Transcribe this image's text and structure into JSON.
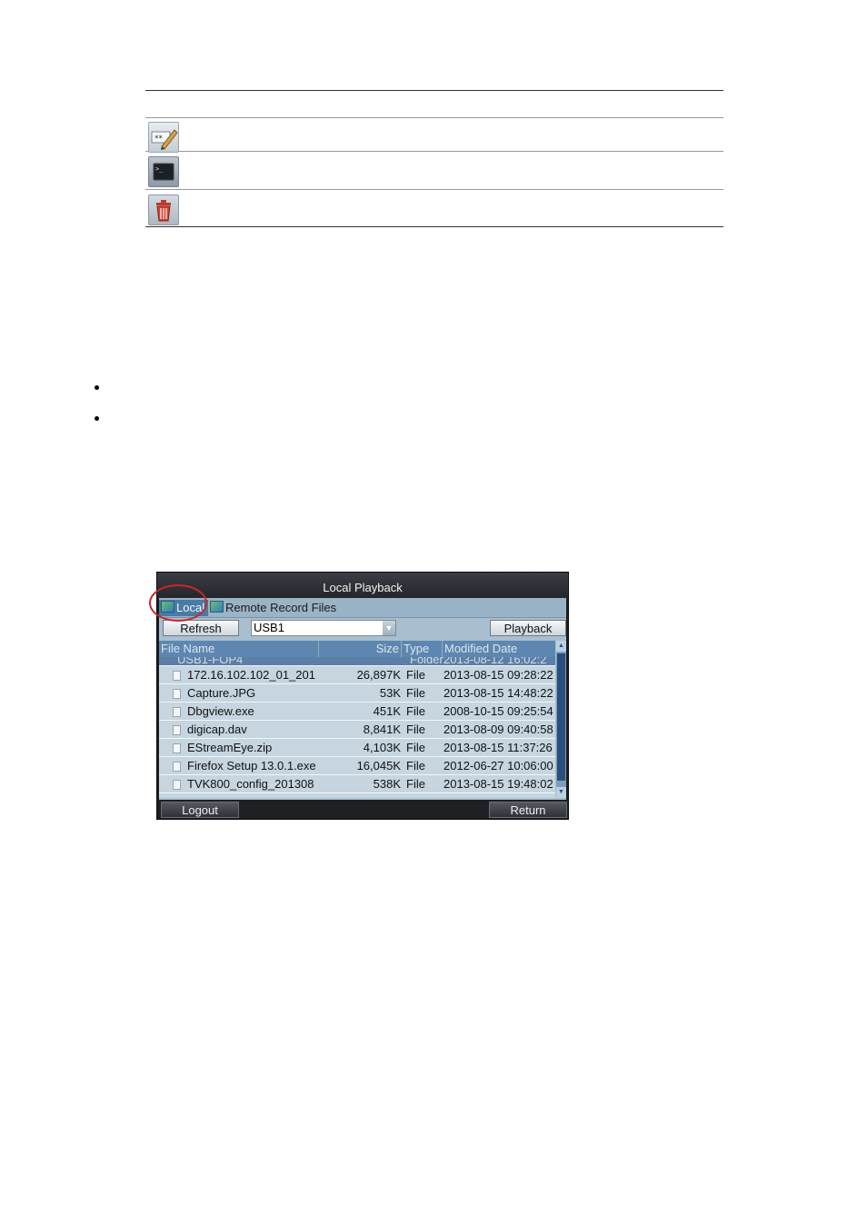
{
  "window": {
    "title": "Local Playback",
    "tabs": [
      {
        "label": "Local",
        "active": true
      },
      {
        "label": "Remote Record Files",
        "active": false
      }
    ],
    "toolbar": {
      "refresh_label": "Refresh",
      "device_value": "USB1",
      "playback_label": "Playback"
    },
    "columns": [
      "File Name",
      "Size",
      "Type",
      "Modified Date"
    ],
    "partial_row": {
      "name": "USB1-FOP4",
      "type": "Folder",
      "date": "2013-08-12 16:02:2"
    },
    "rows": [
      {
        "name": "172.16.102.102_01_201",
        "size": "26,897K",
        "type": "File",
        "date": "2013-08-15 09:28:22"
      },
      {
        "name": "Capture.JPG",
        "size": "53K",
        "type": "File",
        "date": "2013-08-15 14:48:22"
      },
      {
        "name": "Dbgview.exe",
        "size": "451K",
        "type": "File",
        "date": "2008-10-15 09:25:54"
      },
      {
        "name": "digicap.dav",
        "size": "8,841K",
        "type": "File",
        "date": "2013-08-09 09:40:58"
      },
      {
        "name": "EStreamEye.zip",
        "size": "4,103K",
        "type": "File",
        "date": "2013-08-15 11:37:26"
      },
      {
        "name": "Firefox Setup 13.0.1.exe",
        "size": "16,045K",
        "type": "File",
        "date": "2012-06-27 10:06:00"
      },
      {
        "name": "TVK800_config_201308",
        "size": "538K",
        "type": "File",
        "date": "2013-08-15 19:48:02"
      }
    ],
    "footer": {
      "logout_label": "Logout",
      "return_label": "Return"
    }
  },
  "colors": {
    "highlight_circle": "#c8272b",
    "header": "#5d87b0",
    "panel": "#a9bfcf"
  },
  "icons": [
    "edit-password-icon",
    "terminal-icon",
    "delete-icon",
    "file-icon",
    "image-tab-icon"
  ]
}
